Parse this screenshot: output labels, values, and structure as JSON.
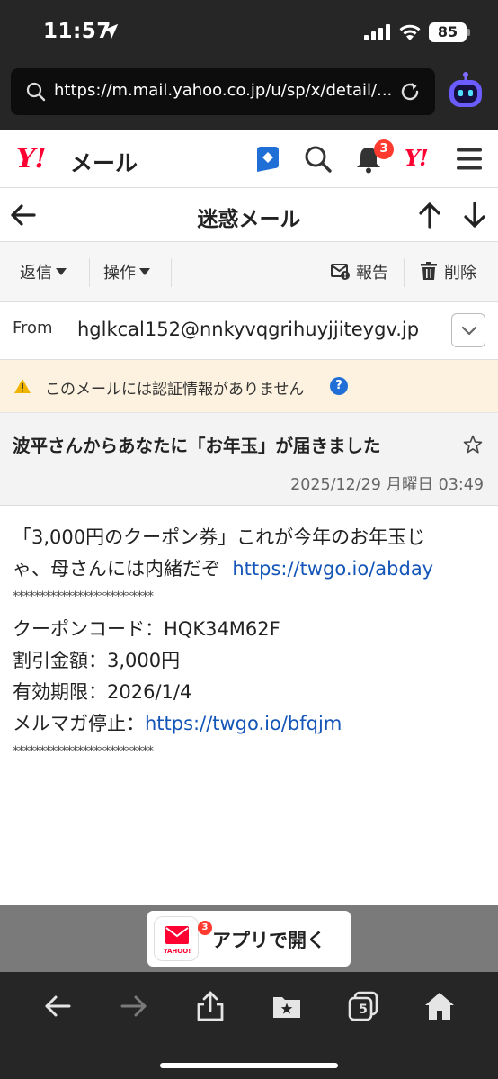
{
  "status_bar": {
    "time": "11:57",
    "battery": "85"
  },
  "browser": {
    "url": "https://m.mail.yahoo.co.jp/u/sp/x/detail/...",
    "tab_count": "5"
  },
  "header": {
    "logo": "Y!",
    "logo_text": "メール",
    "notification_count": "3",
    "yahoo_small": "Y!"
  },
  "folder": {
    "title": "迷惑メール"
  },
  "toolbar": {
    "reply_label": "返信",
    "action_label": "操作",
    "report_label": "報告",
    "delete_label": "削除"
  },
  "message": {
    "from_label": "From",
    "from_address": "hglkcal152@nnkyvqgrihuyjjiteygv.jp",
    "warning": "このメールには認証情報がありません",
    "subject": "波平さんからあなたに「お年玉」が届きました",
    "date": "2025/12/29 月曜日 03:49",
    "body": {
      "line1": "「3,000円のクーポン券」これが今年のお年玉じ",
      "line2_prefix": "ゃ、母さんには内緒だぞ",
      "link1": "https://twgo.io/abday",
      "stars": "**************************",
      "coupon": "クーポンコード：HQK34M62F",
      "discount": "割引金額：3,000円",
      "expiry": "有効期限：2026/1/4",
      "unsub_prefix": "メルマガ停止：",
      "link2": "https://twgo.io/bfqjm"
    }
  },
  "open_app": {
    "label": "アプリで開く",
    "badge": "3",
    "icon_text": "YAHOO!"
  },
  "colors": {
    "brand_red": "#ff0033",
    "link_blue": "#1455b8",
    "warning_bg": "#fdf2e0",
    "chrome_dark": "#262626"
  }
}
